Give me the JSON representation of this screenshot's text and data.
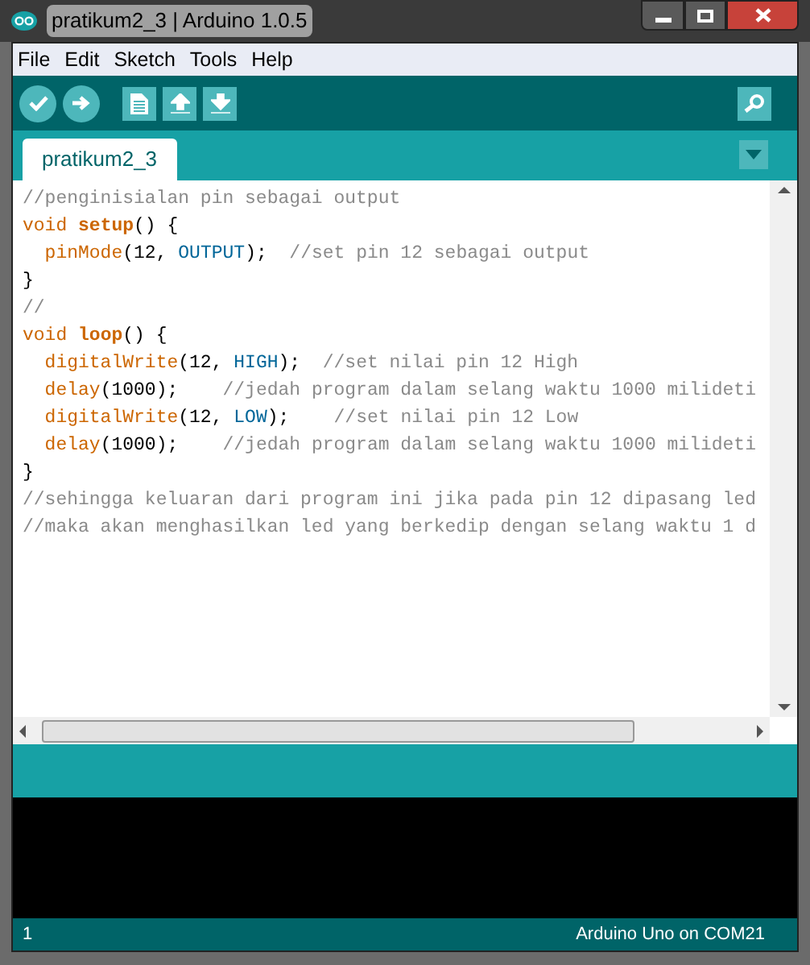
{
  "window": {
    "title": "pratikum2_3 | Arduino 1.0.5"
  },
  "menu": [
    "File",
    "Edit",
    "Sketch",
    "Tools",
    "Help"
  ],
  "tabs": [
    {
      "label": "pratikum2_3",
      "selected": true
    }
  ],
  "code": [
    [
      {
        "kind": "comment",
        "text": "//penginisialan pin sebagai output"
      }
    ],
    [
      {
        "kind": "type",
        "text": "void "
      },
      {
        "kind": "funcdef",
        "text": "setup"
      },
      {
        "kind": "plain",
        "text": "() {"
      }
    ],
    [
      {
        "kind": "func",
        "text": "  pinMode"
      },
      {
        "kind": "plain",
        "text": "(12, "
      },
      {
        "kind": "const",
        "text": "OUTPUT"
      },
      {
        "kind": "plain",
        "text": ");  "
      },
      {
        "kind": "comment",
        "text": "//set pin 12 sebagai output"
      }
    ],
    [
      {
        "kind": "plain",
        "text": "}"
      }
    ],
    [
      {
        "kind": "comment",
        "text": "//"
      }
    ],
    [
      {
        "kind": "type",
        "text": "void "
      },
      {
        "kind": "funcdef",
        "text": "loop"
      },
      {
        "kind": "plain",
        "text": "() {"
      }
    ],
    [
      {
        "kind": "func",
        "text": "  digitalWrite"
      },
      {
        "kind": "plain",
        "text": "(12, "
      },
      {
        "kind": "const",
        "text": "HIGH"
      },
      {
        "kind": "plain",
        "text": ");  "
      },
      {
        "kind": "comment",
        "text": "//set nilai pin 12 High"
      }
    ],
    [
      {
        "kind": "func",
        "text": "  delay"
      },
      {
        "kind": "plain",
        "text": "(1000);    "
      },
      {
        "kind": "comment",
        "text": "//jedah program dalam selang waktu 1000 milideti"
      }
    ],
    [
      {
        "kind": "func",
        "text": "  digitalWrite"
      },
      {
        "kind": "plain",
        "text": "(12, "
      },
      {
        "kind": "const",
        "text": "LOW"
      },
      {
        "kind": "plain",
        "text": ");    "
      },
      {
        "kind": "comment",
        "text": "//set nilai pin 12 Low"
      }
    ],
    [
      {
        "kind": "func",
        "text": "  delay"
      },
      {
        "kind": "plain",
        "text": "(1000);    "
      },
      {
        "kind": "comment",
        "text": "//jedah program dalam selang waktu 1000 milideti"
      }
    ],
    [
      {
        "kind": "plain",
        "text": "}"
      }
    ],
    [
      {
        "kind": "comment",
        "text": "//sehingga keluaran dari program ini jika pada pin 12 dipasang led"
      }
    ],
    [
      {
        "kind": "comment",
        "text": "//maka akan menghasilkan led yang berkedip dengan selang waktu 1 d"
      }
    ]
  ],
  "status_bar": {
    "line": "1",
    "board": "Arduino Uno on COM21"
  }
}
